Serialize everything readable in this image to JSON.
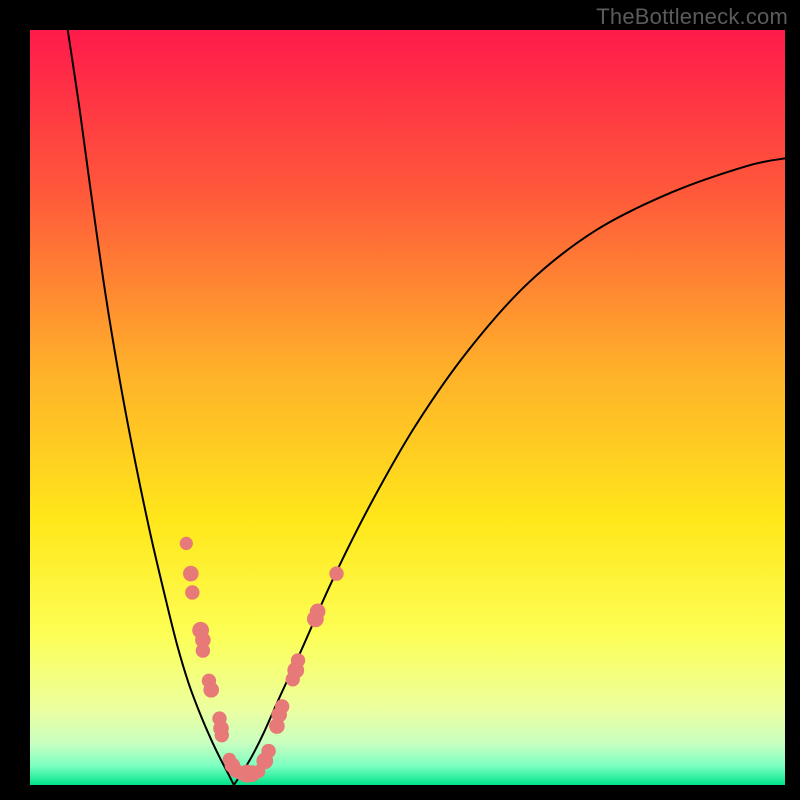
{
  "watermark": "TheBottleneck.com",
  "chart_data": {
    "type": "line",
    "title": "",
    "xlabel": "",
    "ylabel": "",
    "xlim": [
      0,
      100
    ],
    "ylim": [
      0,
      100
    ],
    "background_gradient": {
      "stops": [
        {
          "offset": 0.0,
          "color": "#ff1a4b"
        },
        {
          "offset": 0.22,
          "color": "#ff5a3a"
        },
        {
          "offset": 0.45,
          "color": "#ffb02a"
        },
        {
          "offset": 0.65,
          "color": "#ffe71a"
        },
        {
          "offset": 0.8,
          "color": "#fdff55"
        },
        {
          "offset": 0.9,
          "color": "#ecffa0"
        },
        {
          "offset": 0.945,
          "color": "#c8ffc0"
        },
        {
          "offset": 0.975,
          "color": "#7affc0"
        },
        {
          "offset": 1.0,
          "color": "#00e38a"
        }
      ]
    },
    "series": [
      {
        "name": "left-curve",
        "x": [
          5.0,
          6.5,
          8.0,
          10.0,
          12.0,
          14.0,
          16.0,
          18.0,
          19.5,
          21.0,
          22.5,
          24.0,
          25.2,
          26.2,
          27.0
        ],
        "y": [
          100,
          90.0,
          79.0,
          65.0,
          53.0,
          42.5,
          33.0,
          24.5,
          18.5,
          13.5,
          9.5,
          6.0,
          3.5,
          1.6,
          0.0
        ]
      },
      {
        "name": "right-curve",
        "x": [
          27.0,
          28.2,
          29.5,
          31.0,
          33.0,
          36.0,
          40.0,
          45.0,
          51.0,
          58.0,
          66.0,
          75.0,
          85.0,
          95.0,
          100.0
        ],
        "y": [
          0.0,
          1.8,
          4.0,
          7.0,
          11.5,
          18.0,
          27.0,
          37.0,
          47.5,
          57.5,
          66.5,
          73.5,
          78.5,
          82.0,
          83.0
        ]
      }
    ],
    "scatter": {
      "name": "data-points",
      "color": "#e77a78",
      "points": [
        {
          "x": 20.7,
          "y": 32.0,
          "r": 1.1
        },
        {
          "x": 21.3,
          "y": 28.0,
          "r": 1.3
        },
        {
          "x": 21.5,
          "y": 25.5,
          "r": 1.2
        },
        {
          "x": 22.6,
          "y": 20.5,
          "r": 1.4
        },
        {
          "x": 22.9,
          "y": 19.2,
          "r": 1.3
        },
        {
          "x": 22.9,
          "y": 17.8,
          "r": 1.2
        },
        {
          "x": 23.7,
          "y": 13.8,
          "r": 1.2
        },
        {
          "x": 24.0,
          "y": 12.6,
          "r": 1.3
        },
        {
          "x": 25.1,
          "y": 8.8,
          "r": 1.2
        },
        {
          "x": 25.3,
          "y": 7.5,
          "r": 1.3
        },
        {
          "x": 25.4,
          "y": 6.6,
          "r": 1.2
        },
        {
          "x": 26.4,
          "y": 3.4,
          "r": 1.1
        },
        {
          "x": 26.8,
          "y": 2.6,
          "r": 1.3
        },
        {
          "x": 27.3,
          "y": 1.9,
          "r": 1.2
        },
        {
          "x": 28.0,
          "y": 1.5,
          "r": 1.1
        },
        {
          "x": 28.7,
          "y": 1.5,
          "r": 1.5
        },
        {
          "x": 29.4,
          "y": 1.5,
          "r": 1.4
        },
        {
          "x": 30.3,
          "y": 1.8,
          "r": 1.1
        },
        {
          "x": 31.1,
          "y": 3.2,
          "r": 1.4
        },
        {
          "x": 31.6,
          "y": 4.5,
          "r": 1.2
        },
        {
          "x": 32.7,
          "y": 7.8,
          "r": 1.3
        },
        {
          "x": 33.0,
          "y": 9.3,
          "r": 1.3
        },
        {
          "x": 33.4,
          "y": 10.4,
          "r": 1.2
        },
        {
          "x": 34.8,
          "y": 14.0,
          "r": 1.2
        },
        {
          "x": 35.2,
          "y": 15.2,
          "r": 1.4
        },
        {
          "x": 35.5,
          "y": 16.5,
          "r": 1.2
        },
        {
          "x": 37.8,
          "y": 22.0,
          "r": 1.4
        },
        {
          "x": 38.1,
          "y": 23.0,
          "r": 1.3
        },
        {
          "x": 40.6,
          "y": 28.0,
          "r": 1.2
        }
      ]
    }
  }
}
